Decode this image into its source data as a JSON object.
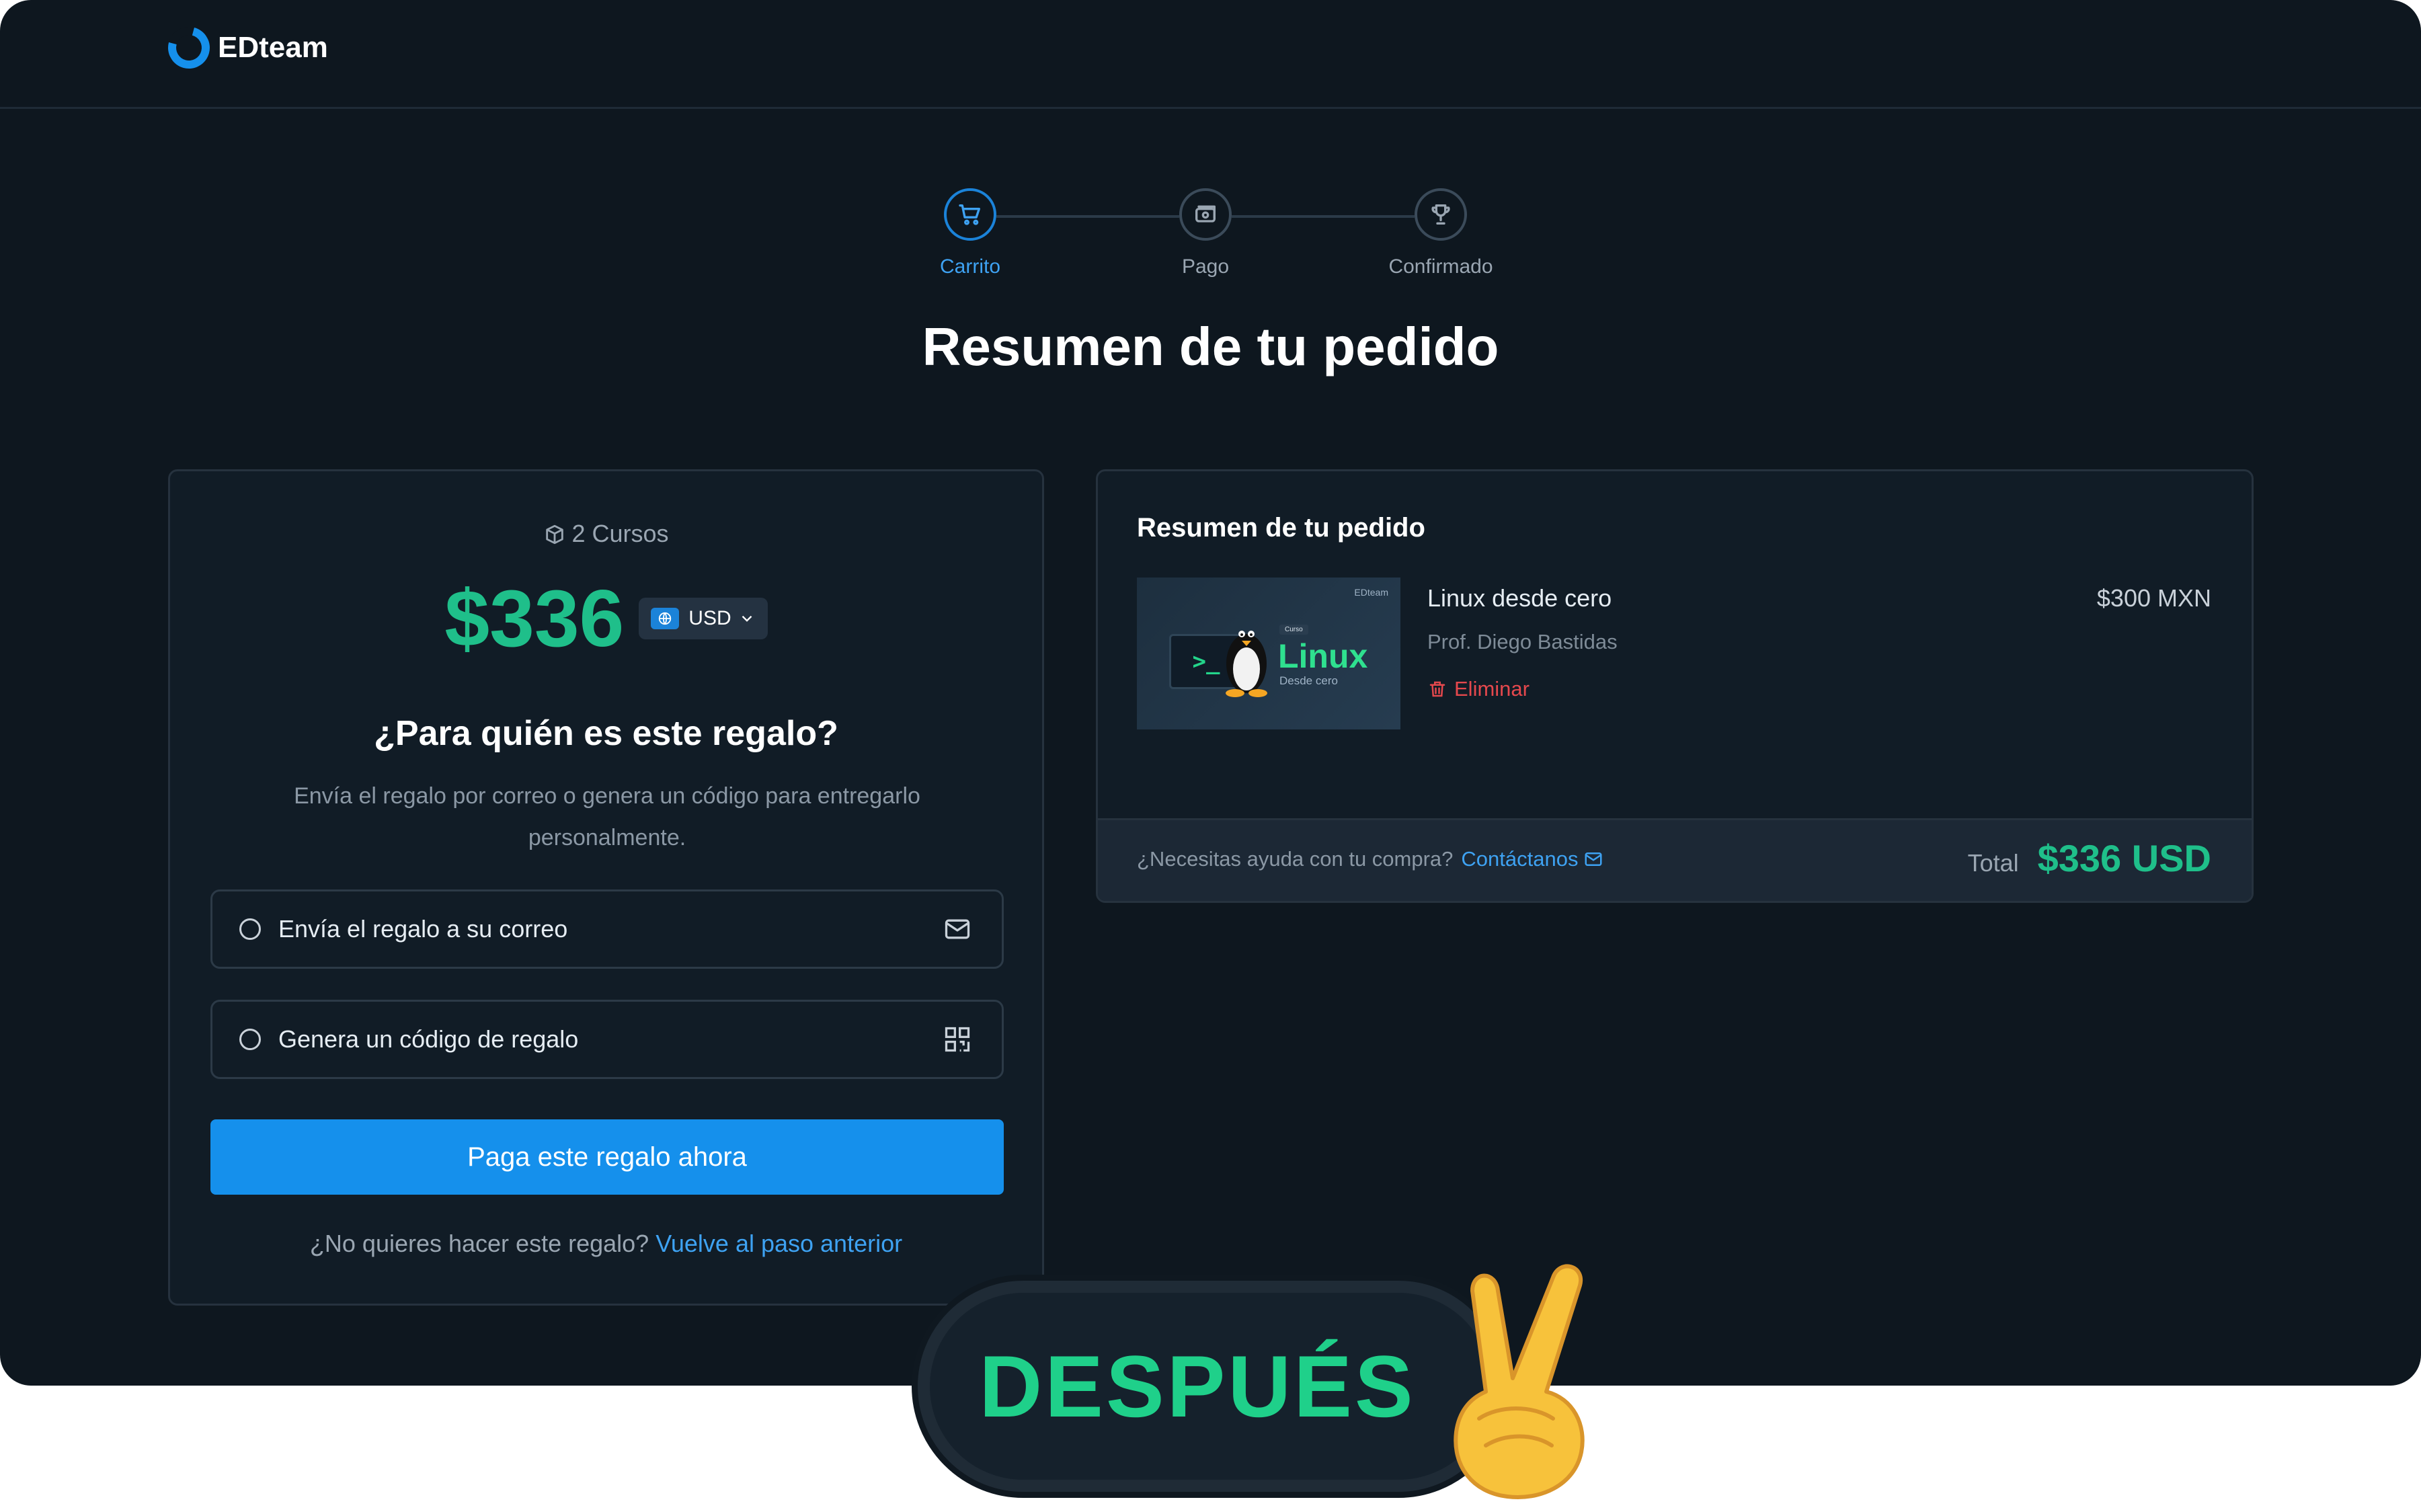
{
  "brand": {
    "name": "EDteam"
  },
  "stepper": {
    "steps": [
      {
        "label": "Carrito",
        "icon": "cart-icon",
        "active": true
      },
      {
        "label": "Pago",
        "icon": "payment-icon",
        "active": false
      },
      {
        "label": "Confirmado",
        "icon": "trophy-icon",
        "active": false
      }
    ]
  },
  "page": {
    "title": "Resumen de tu pedido"
  },
  "gift_card": {
    "courses_count": "2 Cursos",
    "price": "$336",
    "currency": "USD",
    "question": "¿Para quién es este regalo?",
    "subtitle": "Envía el regalo por correo o genera un código para entregarlo personalmente.",
    "options": [
      {
        "label": "Envía el regalo a su correo",
        "icon": "mail-icon"
      },
      {
        "label": "Genera un código de regalo",
        "icon": "qr-code-icon"
      }
    ],
    "pay_button": "Paga este regalo ahora",
    "back_text": "¿No quieres hacer este regalo?",
    "back_link": "Vuelve al paso anterior"
  },
  "summary": {
    "title": "Resumen de tu pedido",
    "item": {
      "name": "Linux desde cero",
      "professor": "Prof. Diego Bastidas",
      "remove": "Eliminar",
      "price": "$300 MXN",
      "thumb_title": "Linux",
      "thumb_subtitle": "Desde cero",
      "thumb_badge": "Curso",
      "thumb_brand": "EDteam",
      "thumb_prompt": ">_"
    },
    "help_text": "¿Necesitas ayuda con tu compra?",
    "help_link": "Contáctanos",
    "total_label": "Total",
    "total_value": "$336 USD"
  },
  "overlay": {
    "label": "DESPUÉS",
    "emoji": "victory-hand-icon"
  },
  "colors": {
    "accent": "#1590ec",
    "price_green": "#1fbf8a",
    "danger": "#e5484d",
    "background": "#0e171f"
  }
}
